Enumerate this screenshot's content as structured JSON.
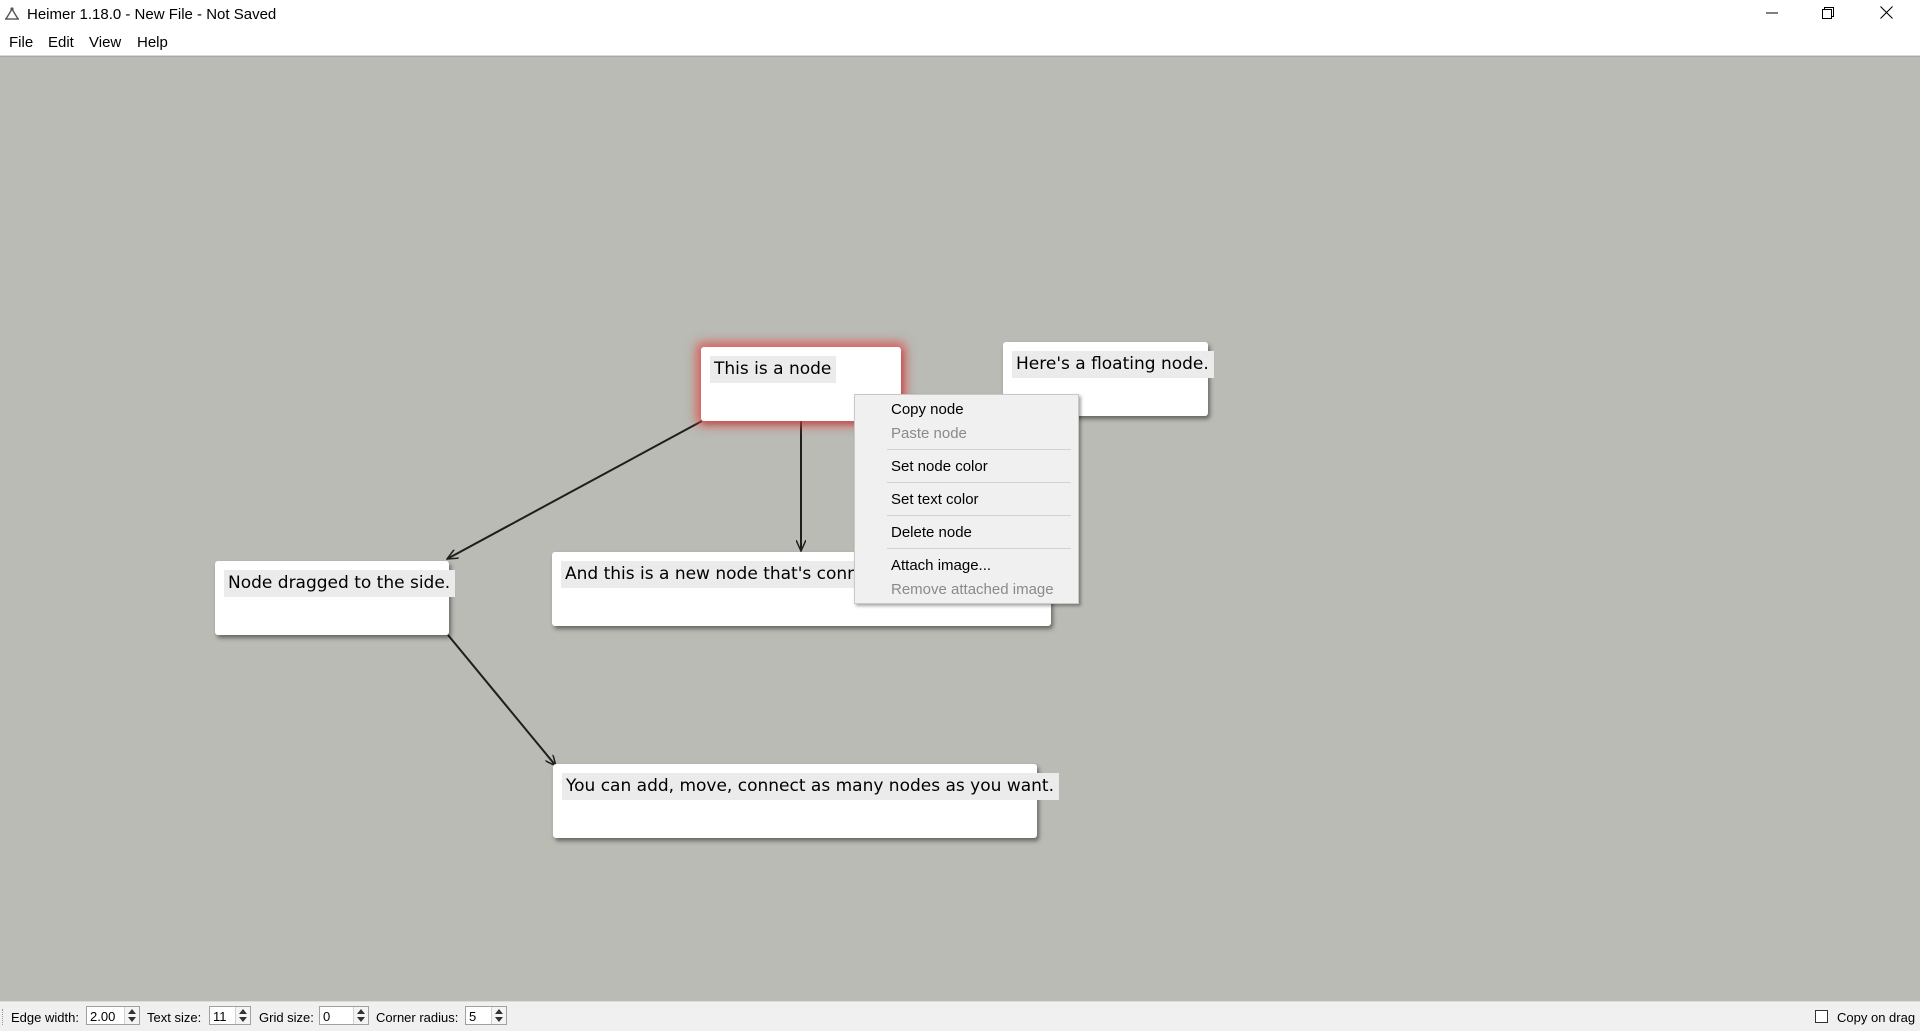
{
  "window": {
    "title": "Heimer 1.18.0 - New File - Not Saved",
    "icon": "heimer-app-icon",
    "controls": [
      "minimize-icon",
      "restore-icon",
      "close-icon"
    ]
  },
  "menubar": {
    "items": [
      {
        "label": "File"
      },
      {
        "label": "Edit"
      },
      {
        "label": "View"
      },
      {
        "label": "Help"
      }
    ]
  },
  "canvas": {
    "background": "#b9bbb4",
    "nodes": [
      {
        "id": "root",
        "text": "This is a node",
        "selected": true
      },
      {
        "id": "floating",
        "text": "Here's a floating node."
      },
      {
        "id": "side",
        "text": "Node dragged to the side."
      },
      {
        "id": "connected",
        "text": "And this is a new node that's connec"
      },
      {
        "id": "bottom",
        "text": "You can add, move, connect as many nodes as you want."
      }
    ],
    "edges": [
      {
        "from": "root",
        "to": "side"
      },
      {
        "from": "root",
        "to": "connected"
      },
      {
        "from": "side",
        "to": "bottom"
      }
    ],
    "selection_color": "#e24646"
  },
  "context_menu": {
    "items": [
      {
        "label": "Copy node",
        "enabled": true
      },
      {
        "label": "Paste node",
        "enabled": false
      },
      {
        "label": "Set node color",
        "enabled": true
      },
      {
        "label": "Set text color",
        "enabled": true
      },
      {
        "label": "Delete node",
        "enabled": true
      },
      {
        "label": "Attach image...",
        "enabled": true
      },
      {
        "label": "Remove attached image",
        "enabled": false
      }
    ]
  },
  "statusbar": {
    "edge_width_label": "Edge width:",
    "edge_width_value": "2.00",
    "text_size_label": "Text size:",
    "text_size_value": "11",
    "grid_size_label": "Grid size:",
    "grid_size_value": "0",
    "corner_radius_label": "Corner radius:",
    "corner_radius_value": "5",
    "copy_on_drag_label": "Copy on drag",
    "copy_on_drag_checked": false
  }
}
